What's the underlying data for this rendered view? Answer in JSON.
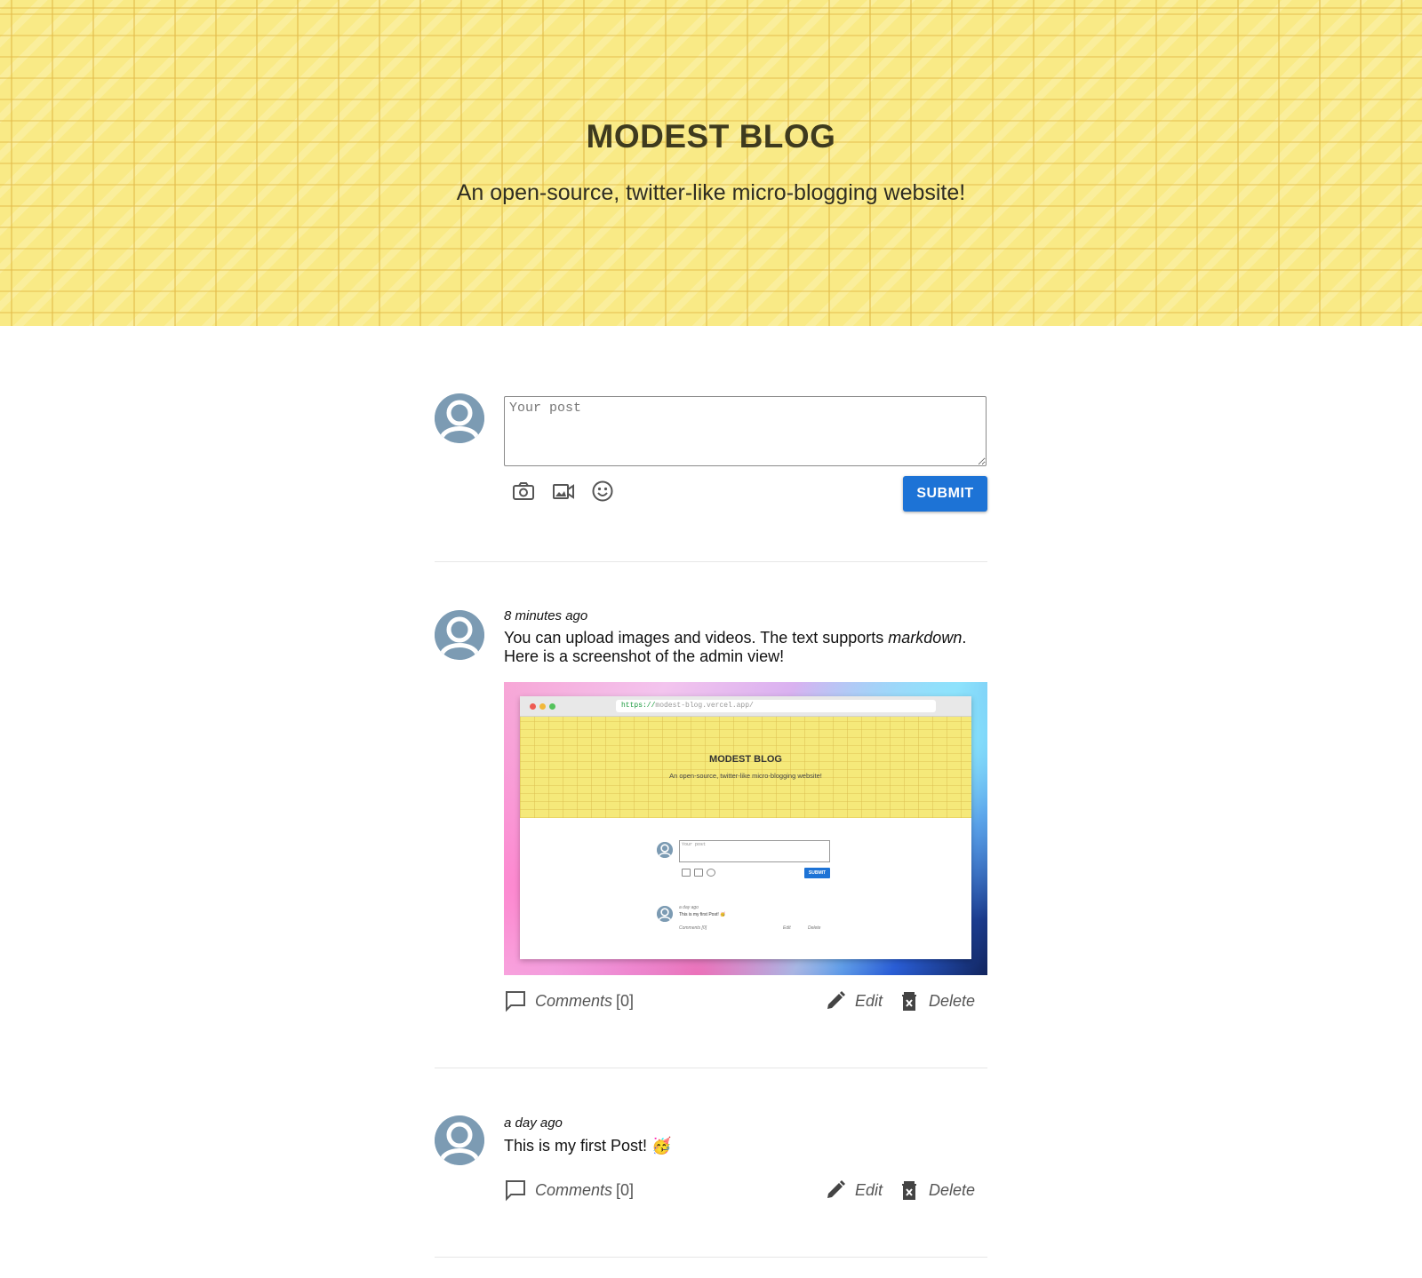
{
  "header": {
    "title": "MODEST BLOG",
    "subtitle": "An open-source, twitter-like micro-blogging website!"
  },
  "composer": {
    "placeholder": "Your post",
    "value": "",
    "icons": [
      "camera-icon",
      "video-icon",
      "emoji-icon"
    ],
    "submit_label": "SUBMIT"
  },
  "posts": [
    {
      "time": "8 minutes ago",
      "text_before": "You can upload images and videos. The text supports ",
      "text_emphasis": "markdown",
      "text_after": ". Here is a screenshot of the admin view!",
      "has_image": true,
      "comments_label": "Comments",
      "comments_count": "[0]",
      "edit_label": "Edit",
      "delete_label": "Delete"
    },
    {
      "time": "a day ago",
      "text": "This is my first Post! 🥳",
      "comments_label": "Comments",
      "comments_count": "[0]",
      "edit_label": "Edit",
      "delete_label": "Delete"
    }
  ],
  "post_image": {
    "url": "https://modest-blog.vercel.app/",
    "url_scheme": "https://",
    "url_rest": "modest-blog.vercel.app/",
    "title": "MODEST BLOG",
    "subtitle": "An open-source, twitter-like micro-blogging website!",
    "placeholder": "Your post",
    "submit_label": "SUBMIT",
    "post_time": "a day ago",
    "post_text": "This is my first Post! 🥳",
    "comments": "Comments [0]",
    "edit": "Edit",
    "delete": "Delete"
  },
  "colors": {
    "header_bg": "#f9ea86",
    "submit_bg": "#1d73d6",
    "avatar": "#7c9bb3"
  }
}
